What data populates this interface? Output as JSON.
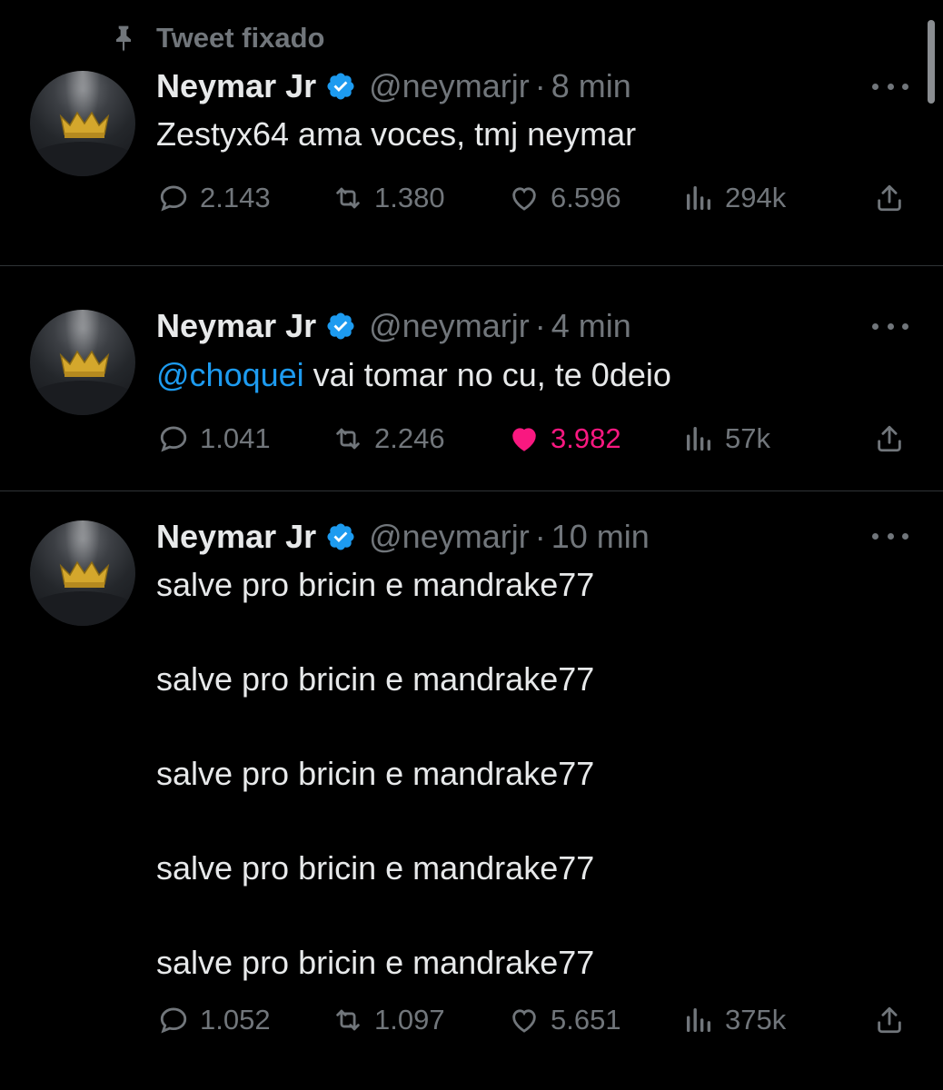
{
  "pinned_label": "Tweet fixado",
  "tweets": [
    {
      "name": "Neymar Jr",
      "handle": "@neymarjr",
      "separator": "·",
      "time": "8 min",
      "mention": "",
      "text": "Zestyx64 ama voces, tmj neymar",
      "replies": "2.143",
      "retweets": "1.380",
      "likes": "6.596",
      "views": "294k",
      "liked": false
    },
    {
      "name": "Neymar Jr",
      "handle": "@neymarjr",
      "separator": "·",
      "time": "4 min",
      "mention": "@choquei",
      "text": " vai tomar no cu, te 0deio",
      "replies": "1.041",
      "retweets": "2.246",
      "likes": "3.982",
      "views": "57k",
      "liked": true
    },
    {
      "name": "Neymar Jr",
      "handle": "@neymarjr",
      "separator": "·",
      "time": "10 min",
      "lines": [
        "salve pro bricin e mandrake77",
        "salve pro bricin e mandrake77",
        "salve pro bricin e mandrake77",
        "salve pro bricin e mandrake77",
        "salve pro bricin e mandrake77"
      ],
      "replies": "1.052",
      "retweets": "1.097",
      "likes": "5.651",
      "views": "375k",
      "liked": false
    }
  ],
  "icons": {
    "pin": "pin-icon",
    "verified": "verified-badge-icon",
    "more": "more-icon",
    "reply": "reply-icon",
    "retweet": "retweet-icon",
    "like": "like-icon",
    "views": "views-icon",
    "share": "share-icon"
  },
  "colors": {
    "background": "#000000",
    "text": "#e7e9ea",
    "secondary": "#71767b",
    "link": "#1d9bf0",
    "like_active": "#f91880",
    "verified": "#1d9bf0",
    "divider": "#2f3336"
  }
}
